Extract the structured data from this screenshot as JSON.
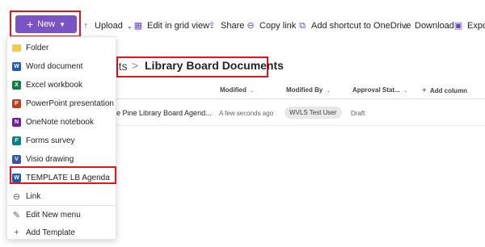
{
  "toolbar": {
    "new_label": "New",
    "upload_label": "Upload",
    "edit_grid_label": "Edit in grid view",
    "share_label": "Share",
    "copy_link_label": "Copy link",
    "add_shortcut_label": "Add shortcut to OneDrive",
    "download_label": "Download",
    "export_label": "Expor"
  },
  "breadcrumb": {
    "previous": "nts",
    "separator": ">",
    "current": "Library Board Documents"
  },
  "columns": {
    "modified": "Modified",
    "modified_by": "Modified By",
    "approval_status": "Approval Stat...",
    "add_column": "Add column"
  },
  "row": {
    "name": "e Pine Library Board Agend...",
    "modified": "A few seconds ago",
    "modified_by": "WVLS Test User",
    "approval_status": "Draft"
  },
  "menu": {
    "items": [
      {
        "label": "Folder",
        "icon": "folder-icon"
      },
      {
        "label": "Word document",
        "icon": "word-icon"
      },
      {
        "label": "Excel workbook",
        "icon": "excel-icon"
      },
      {
        "label": "PowerPoint presentation",
        "icon": "powerpoint-icon"
      },
      {
        "label": "OneNote notebook",
        "icon": "onenote-icon"
      },
      {
        "label": "Forms survey",
        "icon": "forms-icon"
      },
      {
        "label": "Visio drawing",
        "icon": "visio-icon"
      },
      {
        "label": "TEMPLATE LB Agenda",
        "icon": "word-icon"
      },
      {
        "label": "Link",
        "icon": "link-icon"
      },
      {
        "label": "Edit New menu",
        "icon": "pencil-icon"
      },
      {
        "label": "Add Template",
        "icon": "plus-icon"
      }
    ]
  },
  "colors": {
    "accent": "#7a54c4",
    "highlight": "#e3161d"
  }
}
